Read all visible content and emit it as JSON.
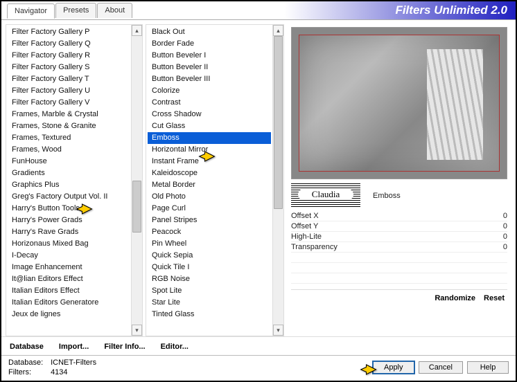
{
  "app_title": "Filters Unlimited 2.0",
  "tabs": [
    "Navigator",
    "Presets",
    "About"
  ],
  "active_tab": 0,
  "left_list": [
    "Filter Factory Gallery P",
    "Filter Factory Gallery Q",
    "Filter Factory Gallery R",
    "Filter Factory Gallery S",
    "Filter Factory Gallery T",
    "Filter Factory Gallery U",
    "Filter Factory Gallery V",
    "Frames, Marble & Crystal",
    "Frames, Stone & Granite",
    "Frames, Textured",
    "Frames, Wood",
    "FunHouse",
    "Gradients",
    "Graphics Plus",
    "Greg's Factory Output Vol. II",
    "Harry's Button Tools",
    "Harry's Power Grads",
    "Harry's Rave Grads",
    "Horizonaus Mixed Bag",
    "I-Decay",
    "Image Enhancement",
    "It@lian Editors Effect",
    "Italian Editors Effect",
    "Italian Editors Generatore",
    "Jeux de lignes"
  ],
  "mid_list": [
    "Black Out",
    "Border Fade",
    "Button Beveler I",
    "Button Beveler II",
    "Button Beveler III",
    "Colorize",
    "Contrast",
    "Cross Shadow",
    "Cut Glass",
    "Emboss",
    "Horizontal Mirror",
    "Instant Frame",
    "Kaleidoscope",
    "Metal Border",
    "Old Photo",
    "Page Curl",
    "Panel Stripes",
    "Peacock",
    "Pin Wheel",
    "Quick Sepia",
    "Quick Tile I",
    "RGB Noise",
    "Spot Lite",
    "Star Lite",
    "Tinted Glass"
  ],
  "mid_selected_index": 9,
  "selected_filter_name": "Emboss",
  "params": [
    {
      "name": "Offset X",
      "value": 0
    },
    {
      "name": "Offset Y",
      "value": 0
    },
    {
      "name": "High-Lite",
      "value": 0
    },
    {
      "name": "Transparency",
      "value": 0
    }
  ],
  "bottom_links": [
    "Database",
    "Import...",
    "Filter Info...",
    "Editor..."
  ],
  "right_actions": [
    "Randomize",
    "Reset"
  ],
  "status": {
    "db_label": "Database:",
    "db_value": "ICNET-Filters",
    "filters_label": "Filters:",
    "filters_value": "4134"
  },
  "buttons": {
    "apply": "Apply",
    "cancel": "Cancel",
    "help": "Help"
  }
}
